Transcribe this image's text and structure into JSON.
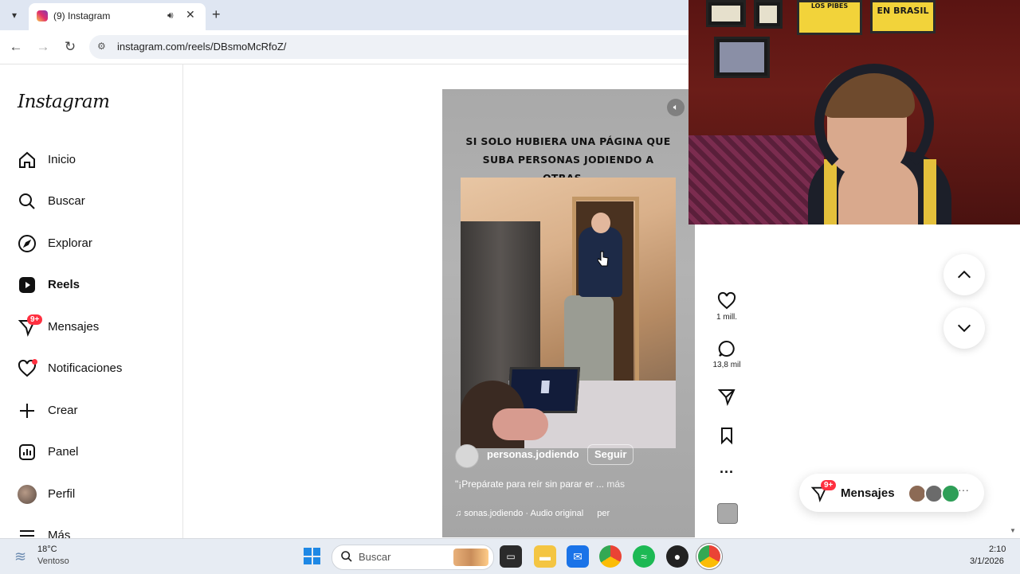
{
  "browser": {
    "tab_title": "(9) Instagram",
    "url": "instagram.com/reels/DBsmoMcRfoZ/"
  },
  "sidebar": {
    "logo": "Instagram",
    "items": [
      {
        "label": "Inicio",
        "icon": "home-icon"
      },
      {
        "label": "Buscar",
        "icon": "search-icon"
      },
      {
        "label": "Explorar",
        "icon": "compass-icon"
      },
      {
        "label": "Reels",
        "icon": "reels-icon",
        "active": true
      },
      {
        "label": "Mensajes",
        "icon": "messenger-icon",
        "badge": "9+"
      },
      {
        "label": "Notificaciones",
        "icon": "heart-icon"
      },
      {
        "label": "Crear",
        "icon": "plus-icon"
      },
      {
        "label": "Panel",
        "icon": "chart-icon"
      },
      {
        "label": "Perfil",
        "icon": "avatar-icon"
      },
      {
        "label": "Más",
        "icon": "menu-icon"
      }
    ]
  },
  "reel": {
    "overlay_text": "SI SOLO HUBIERA UNA PÁGINA QUE SUBA PERSONAS  JODIENDO A OTRAS...",
    "author": "personas.jodiendo",
    "follow_label": "Seguir",
    "description": "\"¡Prepárate para reír sin parar er ...",
    "more_label": "más",
    "audio": "sonas.jodiendo · Audio original",
    "audio_tail": "per"
  },
  "actions": {
    "likes": "1 mill.",
    "comments": "13,8 mil"
  },
  "messages_pill": {
    "label": "Mensajes",
    "badge": "9+"
  },
  "webcam": {
    "poster_1": "LOS PIBES",
    "poster_2": "EN BRASIL"
  },
  "taskbar": {
    "temperature": "18°C",
    "weather": "Ventoso",
    "search_label": "Buscar",
    "time": "2:10",
    "date": "3/1/2026"
  }
}
